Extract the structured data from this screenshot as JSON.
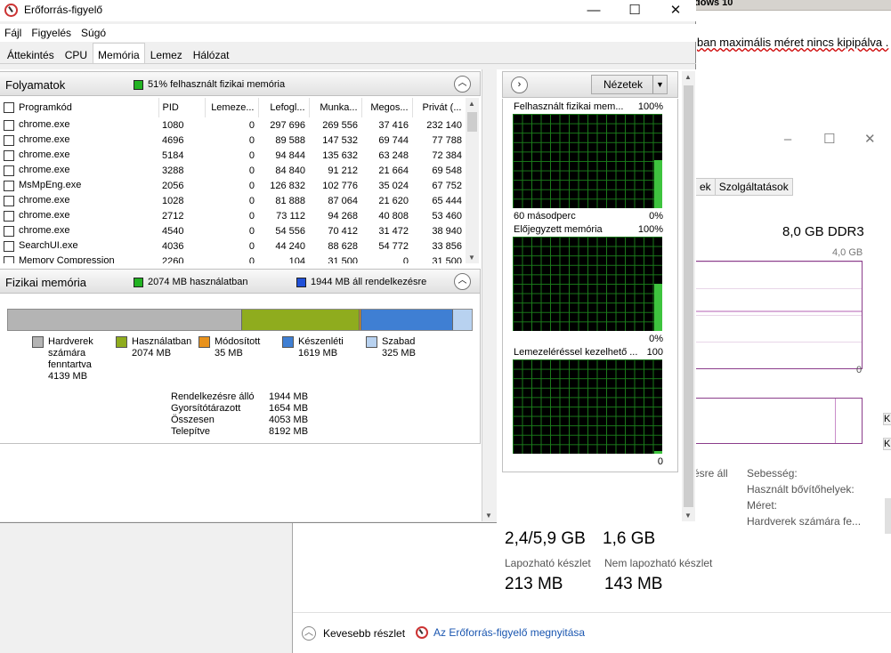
{
  "background_doc": {
    "title_fragment": "dows 10",
    "text_fragment": "ban maximális méret nincs kipipálva ."
  },
  "task_manager": {
    "tab_partial": "ek",
    "tab_services": "Szolgáltatások",
    "memory_type": "8,0 GB DDR3",
    "graph_max": "4,0 GB",
    "graph_min": "0",
    "edge_label": "K",
    "partial_available": "ésre áll",
    "stats_labels": [
      "Sebesség:",
      "Használt bővítőhelyek:",
      "Méret:",
      "Hardverek számára fe..."
    ],
    "committed_value": "2,4/5,9 GB",
    "cached_value": "1,6 GB",
    "paged_label": "Lapozható készlet",
    "nonpaged_label": "Nem lapozható készlet",
    "paged_value": "213 MB",
    "nonpaged_value": "143 MB",
    "fewer_details": "Kevesebb részlet",
    "open_resmon": "Az Erőforrás-figyelő megnyitása"
  },
  "window": {
    "title": "Erőforrás-figyelő",
    "menu": [
      "Fájl",
      "Figyelés",
      "Súgó"
    ],
    "tabs": [
      "Áttekintés",
      "CPU",
      "Memória",
      "Lemez",
      "Hálózat"
    ],
    "active_tab": "Memória"
  },
  "processes": {
    "title": "Folyamatok",
    "indicator": "51% felhasznált fizikai memória",
    "columns": [
      "Programkód",
      "PID",
      "Lemeze...",
      "Lefogl...",
      "Munka...",
      "Megos...",
      "Privát (..."
    ],
    "rows": [
      [
        "chrome.exe",
        "1080",
        "0",
        "297 696",
        "269 556",
        "37 416",
        "232 140"
      ],
      [
        "chrome.exe",
        "4696",
        "0",
        "89 588",
        "147 532",
        "69 744",
        "77 788"
      ],
      [
        "chrome.exe",
        "5184",
        "0",
        "94 844",
        "135 632",
        "63 248",
        "72 384"
      ],
      [
        "chrome.exe",
        "3288",
        "0",
        "84 840",
        "91 212",
        "21 664",
        "69 548"
      ],
      [
        "MsMpEng.exe",
        "2056",
        "0",
        "126 832",
        "102 776",
        "35 024",
        "67 752"
      ],
      [
        "chrome.exe",
        "1028",
        "0",
        "81 888",
        "87 064",
        "21 620",
        "65 444"
      ],
      [
        "chrome.exe",
        "2712",
        "0",
        "73 112",
        "94 268",
        "40 808",
        "53 460"
      ],
      [
        "chrome.exe",
        "4540",
        "0",
        "54 556",
        "70 412",
        "31 472",
        "38 940"
      ],
      [
        "SearchUI.exe",
        "4036",
        "0",
        "44 240",
        "88 628",
        "54 772",
        "33 856"
      ],
      [
        "Memory Compression",
        "2260",
        "0",
        "104",
        "31 500",
        "0",
        "31 500"
      ]
    ]
  },
  "physical": {
    "title": "Fizikai memória",
    "in_use": "2074 MB használatban",
    "available": "1944 MB áll rendelkezésre",
    "bar_segments": [
      {
        "name": "reserved",
        "mb": 4139,
        "color": "#b4b4b4"
      },
      {
        "name": "in_use",
        "mb": 2074,
        "color": "#8fac1e"
      },
      {
        "name": "modified",
        "mb": 35,
        "color": "#e8921c"
      },
      {
        "name": "standby",
        "mb": 1619,
        "color": "#3f7fd3"
      },
      {
        "name": "free",
        "mb": 325,
        "color": "#b8d2f0"
      }
    ],
    "legend": [
      {
        "label": "Hardverek számára fenntartva",
        "value": "4139 MB",
        "color": "#b4b4b4"
      },
      {
        "label": "Használatban",
        "value": "2074 MB",
        "color": "#8fac1e"
      },
      {
        "label": "Módosított",
        "value": "35 MB",
        "color": "#e8921c"
      },
      {
        "label": "Készenléti",
        "value": "1619 MB",
        "color": "#3f7fd3"
      },
      {
        "label": "Szabad",
        "value": "325 MB",
        "color": "#b8d2f0"
      }
    ],
    "stats": [
      {
        "k": "Rendelkezésre álló",
        "v": "1944 MB"
      },
      {
        "k": "Gyorsítótárazott",
        "v": "1654 MB"
      },
      {
        "k": "Összesen",
        "v": "4053 MB"
      },
      {
        "k": "Telepítve",
        "v": "8192 MB"
      }
    ]
  },
  "right_panel": {
    "views_button": "Nézetek",
    "graphs": [
      {
        "title": "Felhasznált fizikai mem...",
        "max": "100%",
        "bottom_left": "60 másodperc",
        "bottom_right": "0%",
        "level": 0.51
      },
      {
        "title": "Előjegyzett memória",
        "max": "100%",
        "bottom_left": "",
        "bottom_right": "0%",
        "level": 0.5
      },
      {
        "title": "Lemezeléréssel kezelhető ...",
        "max": "100",
        "bottom_left": "",
        "bottom_right": "0",
        "level": 0.03
      }
    ]
  }
}
